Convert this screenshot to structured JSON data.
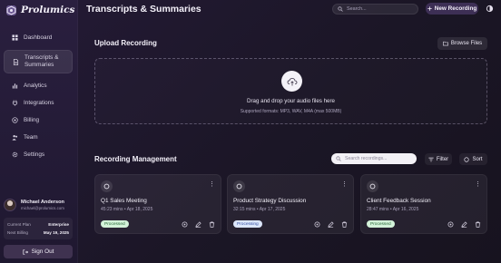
{
  "app": {
    "name": "Prolumics"
  },
  "header": {
    "title": "Transcripts & Summaries",
    "search_placeholder": "Search...",
    "new_recording_label": "New Recording"
  },
  "sidebar": {
    "items": [
      {
        "label": "Dashboard",
        "icon": "grid-icon",
        "active": false
      },
      {
        "label": "Transcripts & Summaries",
        "icon": "document-icon",
        "active": true
      },
      {
        "label": "Analytics",
        "icon": "bar-chart-icon",
        "active": false
      },
      {
        "label": "Integrations",
        "icon": "plug-icon",
        "active": false
      },
      {
        "label": "Billing",
        "icon": "coin-icon",
        "active": false
      },
      {
        "label": "Team",
        "icon": "users-icon",
        "active": false
      },
      {
        "label": "Settings",
        "icon": "gear-icon",
        "active": false
      }
    ]
  },
  "user": {
    "name": "Michael Anderson",
    "email": "michael@prolumics.com",
    "current_plan_label": "Current Plan",
    "current_plan_value": "Enterprise",
    "next_billing_label": "Next Billing",
    "next_billing_value": "May 19, 2025",
    "sign_out_label": "Sign Out"
  },
  "upload": {
    "title": "Upload Recording",
    "browse_label": "Browse Files",
    "drop_text": "Drag and drop your audio files here",
    "formats_text": "Supported formats: MP3, WAV, M4A (max 500MB)"
  },
  "recordings": {
    "title": "Recording Management",
    "search_placeholder": "Search recordings...",
    "filter_label": "Filter",
    "sort_label": "Sort",
    "items": [
      {
        "title": "Q1 Sales Meeting",
        "meta": "45:23 mins • Apr 18, 2025",
        "status": "Processed"
      },
      {
        "title": "Product Strategy Discussion",
        "meta": "32:15 mins • Apr 17, 2025",
        "status": "Processing"
      },
      {
        "title": "Client Feedback Session",
        "meta": "28:47 mins • Apr 16, 2025",
        "status": "Processed"
      }
    ]
  },
  "colors": {
    "accent": "#3d2f55",
    "processed_badge": "#d3f2d9",
    "processing_badge": "#dce6fb"
  }
}
